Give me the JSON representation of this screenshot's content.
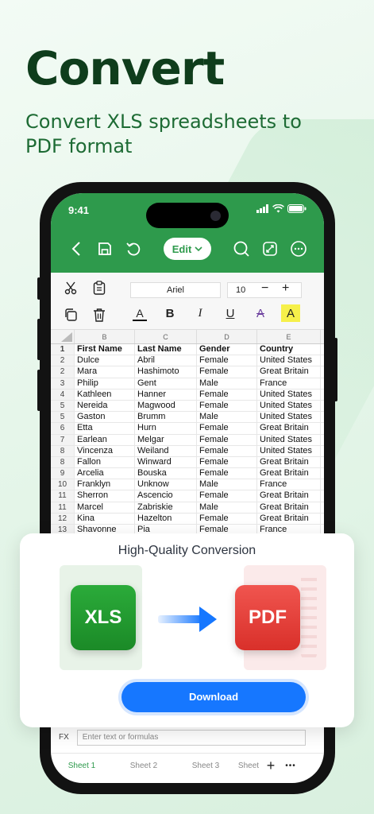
{
  "hero": {
    "title": "Convert",
    "subtitle": "Convert XLS spreadsheets to PDF format"
  },
  "status_bar": {
    "time": "9:41"
  },
  "toolbar": {
    "edit_label": "Edit"
  },
  "ribbon": {
    "font_name": "Ariel",
    "font_size": "10",
    "minus": "−",
    "plus": "+",
    "bold": "B",
    "italic": "I",
    "underline": "U",
    "strike": "A",
    "highlight": "A",
    "text_color": "A"
  },
  "sheet": {
    "columns": [
      "B",
      "C",
      "D",
      "E"
    ],
    "header_row": {
      "num": "1",
      "cells": [
        "First Name",
        "Last Name",
        "Gender",
        "Country"
      ]
    },
    "rows": [
      {
        "num": "2",
        "cells": [
          "Dulce",
          "Abril",
          "Female",
          "United States"
        ]
      },
      {
        "num": "2",
        "cells": [
          "Mara",
          "Hashimoto",
          "Female",
          "Great Britain"
        ]
      },
      {
        "num": "3",
        "cells": [
          "Philip",
          "Gent",
          "Male",
          "France"
        ]
      },
      {
        "num": "4",
        "cells": [
          "Kathleen",
          "Hanner",
          "Female",
          "United States"
        ]
      },
      {
        "num": "5",
        "cells": [
          "Nereida",
          "Magwood",
          "Female",
          "United States"
        ]
      },
      {
        "num": "5",
        "cells": [
          "Gaston",
          "Brumm",
          "Male",
          "United States"
        ]
      },
      {
        "num": "6",
        "cells": [
          "Etta",
          "Hurn",
          "Female",
          "Great Britain"
        ]
      },
      {
        "num": "7",
        "cells": [
          "Earlean",
          "Melgar",
          "Female",
          "United States"
        ]
      },
      {
        "num": "8",
        "cells": [
          "Vincenza",
          "Weiland",
          "Female",
          "United States"
        ]
      },
      {
        "num": "8",
        "cells": [
          "Fallon",
          "Winward",
          "Female",
          "Great Britain"
        ]
      },
      {
        "num": "9",
        "cells": [
          "Arcelia",
          "Bouska",
          "Female",
          "Great Britain"
        ]
      },
      {
        "num": "10",
        "cells": [
          "Franklyn",
          "Unknow",
          "Male",
          "France"
        ]
      },
      {
        "num": "11",
        "cells": [
          "Sherron",
          "Ascencio",
          "Female",
          "Great Britain"
        ]
      },
      {
        "num": "11",
        "cells": [
          "Marcel",
          "Zabriskie",
          "Male",
          "Great Britain"
        ]
      },
      {
        "num": "12",
        "cells": [
          "Kina",
          "Hazelton",
          "Female",
          "Great Britain"
        ]
      },
      {
        "num": "13",
        "cells": [
          "Shavonne",
          "Pia",
          "Female",
          "France"
        ]
      }
    ]
  },
  "formula_bar": {
    "label": "FX",
    "placeholder": "Enter text or formulas"
  },
  "sheet_tabs": [
    "Sheet 1",
    "Sheet 2",
    "Sheet 3",
    "Sheet"
  ],
  "sheet_add": "+",
  "sheet_more": "•••",
  "card": {
    "title": "High-Quality Conversion",
    "source_label": "XLS",
    "target_label": "PDF",
    "download_label": "Download"
  },
  "colors": {
    "brand_green": "#2e9a4c",
    "xls_green": "#1f9a2e",
    "pdf_red": "#e53935",
    "download_blue": "#1677ff"
  }
}
